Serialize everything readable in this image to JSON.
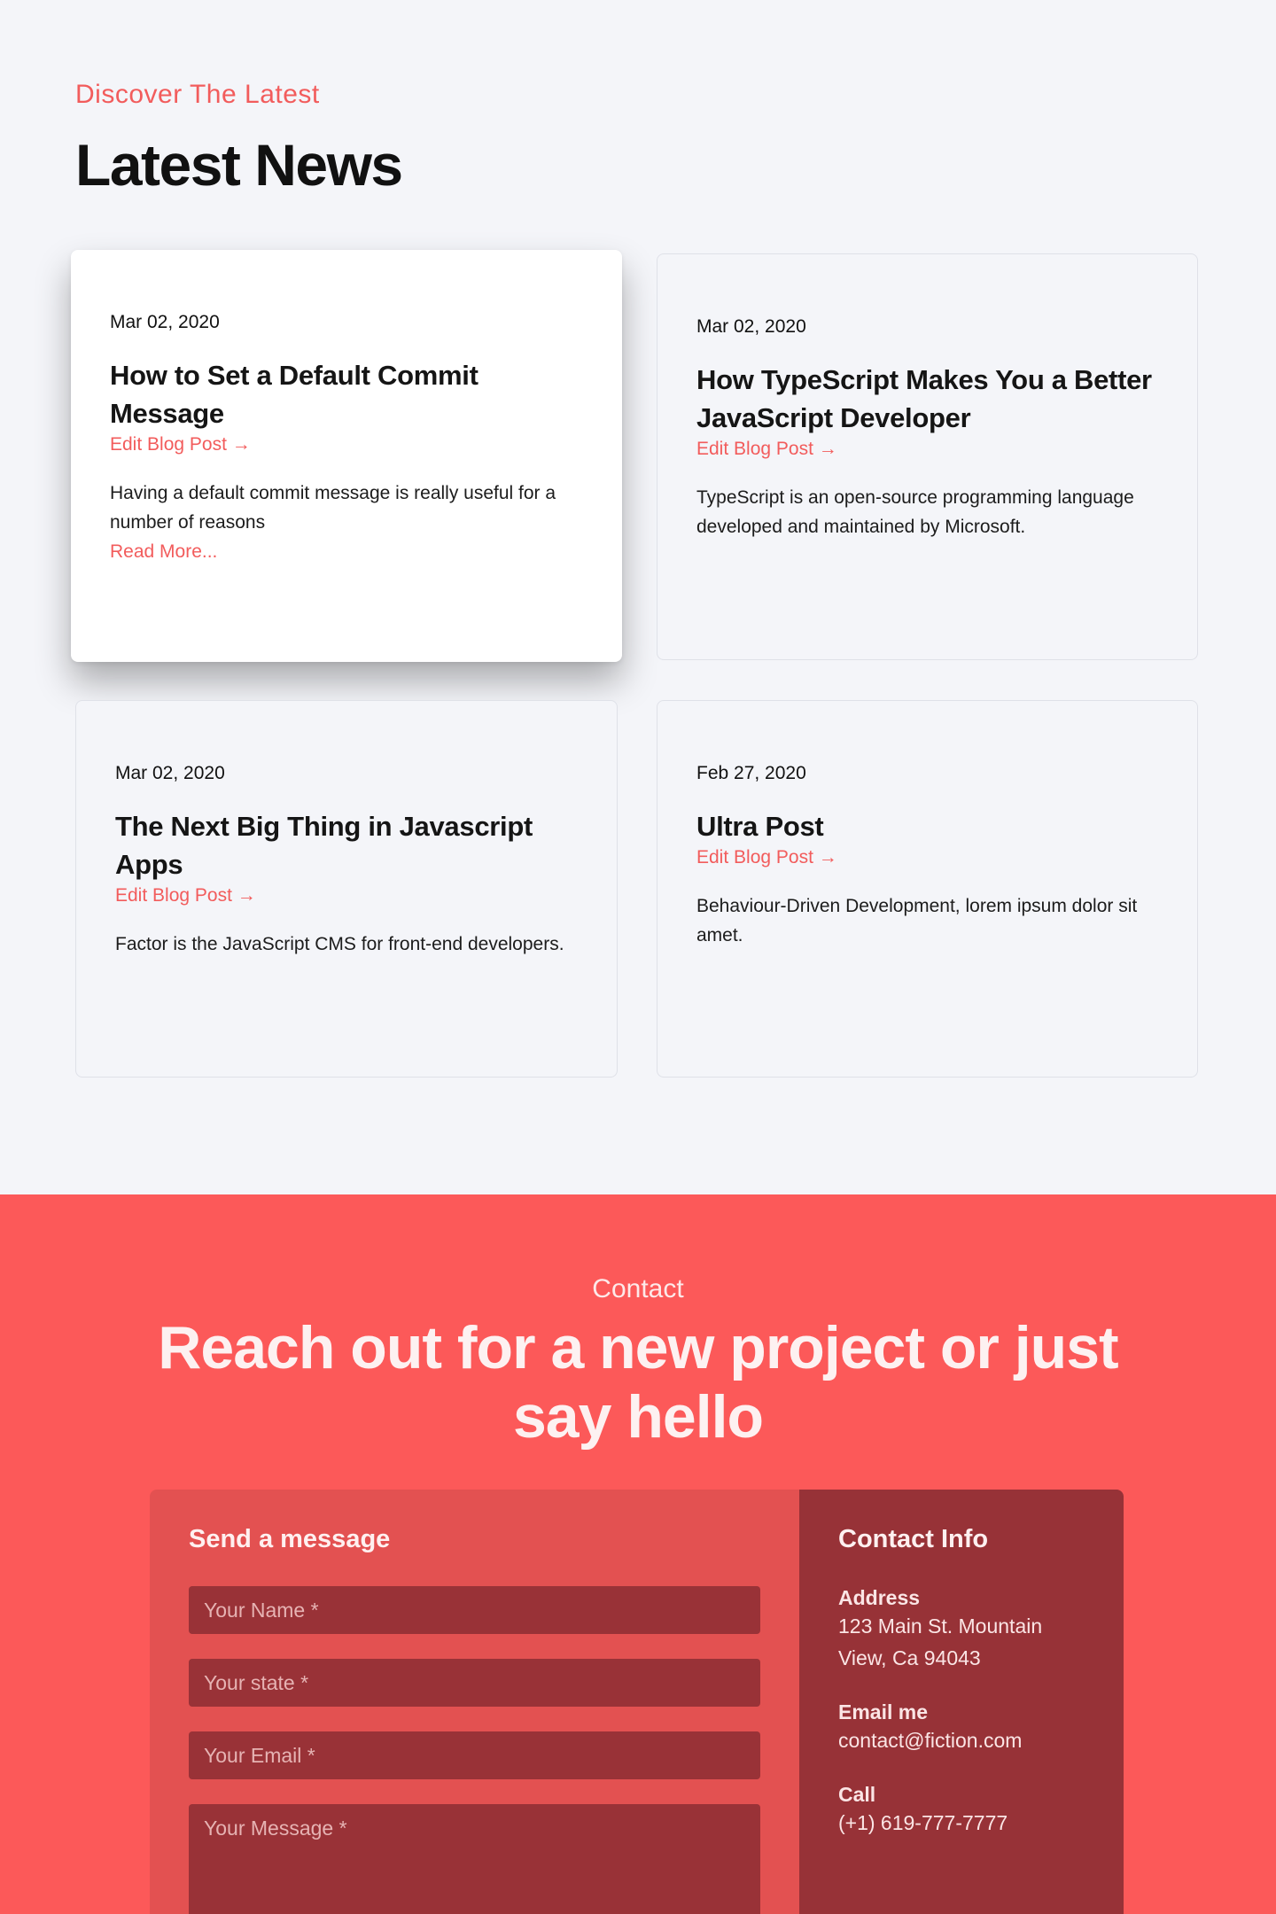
{
  "news": {
    "kicker": "Discover The Latest",
    "heading": "Latest News",
    "posts": [
      {
        "date": "Mar 02, 2020",
        "title": "How to Set a Default Commit Message",
        "edit_label": "Edit Blog Post →",
        "excerpt": "Having a default commit message is really useful for a number of reasons",
        "read_more": "Read More..."
      },
      {
        "date": "Mar 02, 2020",
        "title": "How TypeScript Makes You a Better JavaScript Developer",
        "edit_label": "Edit Blog Post →",
        "excerpt": "TypeScript is an open-source programming language developed and maintained by Microsoft."
      },
      {
        "date": "Mar 02, 2020",
        "title": "The Next Big Thing in Javascript Apps",
        "edit_label": "Edit Blog Post →",
        "excerpt": "Factor is the JavaScript CMS for front-end developers."
      },
      {
        "date": "Feb 27, 2020",
        "title": "Ultra Post",
        "edit_label": "Edit Blog Post →",
        "excerpt": "Behaviour-Driven Development, lorem ipsum dolor sit amet."
      }
    ]
  },
  "contact": {
    "kicker": "Contact",
    "heading": "Reach out for a new project or just say hello",
    "form": {
      "title": "Send a message",
      "name_placeholder": "Your Name *",
      "state_placeholder": "Your state *",
      "email_placeholder": "Your Email *",
      "message_placeholder": "Your Message *"
    },
    "info": {
      "title": "Contact Info",
      "address_label": "Address",
      "address_value": "123 Main St. Mountain View, Ca 94043",
      "email_label": "Email me",
      "email_value": "contact@fiction.com",
      "call_label": "Call",
      "call_value": "(+1) 619-777-7777"
    }
  },
  "colors": {
    "accent": "#f25c5c",
    "contact_bg": "#fc5959",
    "form_panel": "#e35151",
    "info_panel": "#973237",
    "page_bg": "#f4f5f9"
  }
}
